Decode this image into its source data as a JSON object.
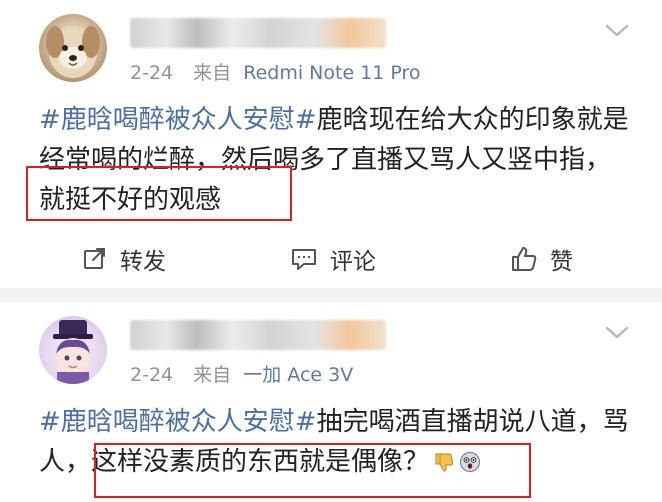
{
  "feed": {
    "posts": [
      {
        "date": "2-24",
        "source_prefix": "来自",
        "device": "Redmi Note 11 Pro",
        "hashtag": "#鹿晗喝醉被众人安慰#",
        "text_lines": [
          "鹿晗现在给大众的印象就是",
          "经常喝的烂醉，然后喝多了直播又骂人又竖中指，",
          "就挺不好的观感"
        ],
        "actions": {
          "repost_label": "转发",
          "comment_label": "评论",
          "like_label": "赞"
        }
      },
      {
        "date": "2-24",
        "source_prefix": "来自",
        "device": "一加 Ace 3V",
        "hashtag": "#鹿晗喝醉被众人安慰#",
        "text_lines": [
          "抽完喝酒直播胡说八道，骂",
          "人，这样没素质的东西就是偶像？"
        ]
      }
    ]
  },
  "colors": {
    "hashtag": "#4a6ea5",
    "meta_gray": "#939393",
    "device_blue": "#5f7aa1",
    "highlight_border": "#e21d1d",
    "separator": "#f2f2f2"
  },
  "icons": {
    "repost": "repost-icon",
    "comment": "comment-icon",
    "like": "thumbs-up-icon",
    "menu": "chevron-down-icon",
    "emoji1": "thumbs-down-emoji",
    "emoji2": "shocked-face-emoji"
  }
}
